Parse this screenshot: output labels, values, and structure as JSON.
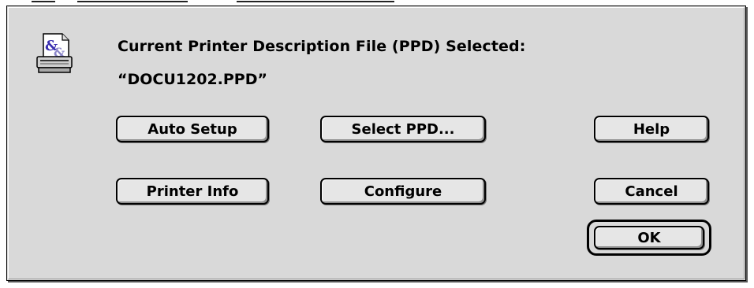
{
  "dialog": {
    "heading": "Current Printer Description File (PPD) Selected:",
    "selected_file": "“DOCU1202.PPD”",
    "icon": "printer-document-icon"
  },
  "buttons": {
    "auto_setup": "Auto Setup",
    "select_ppd": "Select PPD...",
    "help": "Help",
    "printer_info": "Printer Info",
    "configure": "Configure",
    "cancel": "Cancel",
    "ok": "OK"
  },
  "colors": {
    "dialog_background": "#d9d9d9",
    "button_face": "#e6e6e6",
    "icon_ampersand": "#3a2fb0"
  }
}
